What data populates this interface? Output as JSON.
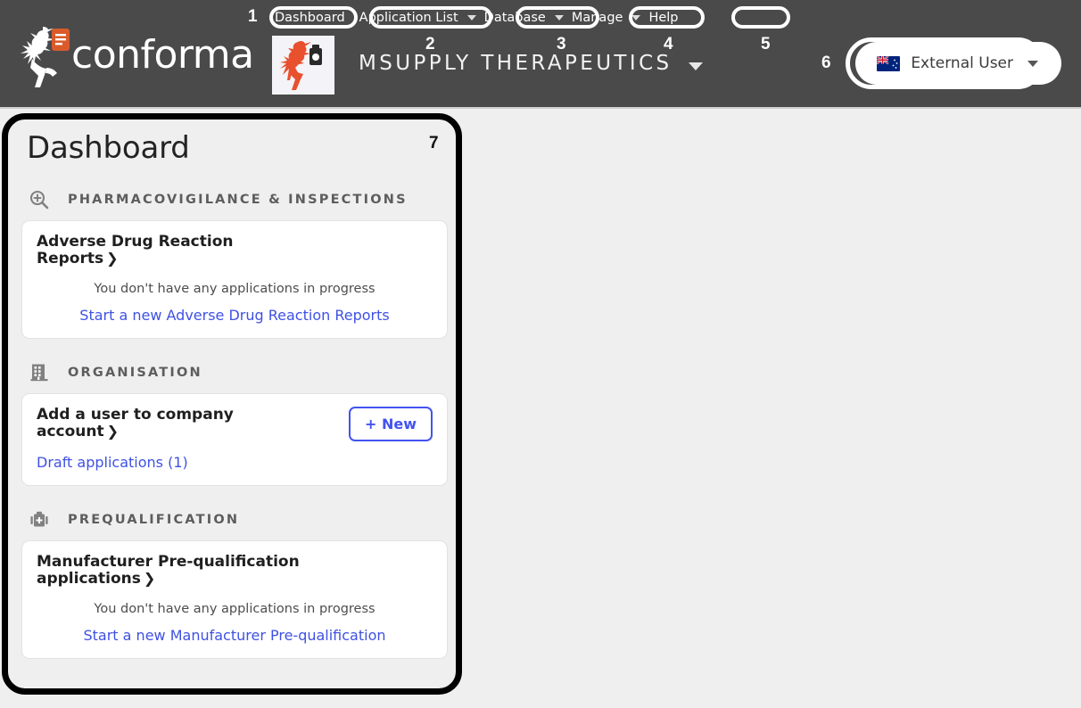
{
  "header": {
    "brand_name": "conforma",
    "brand_icon": "conforma-runner-document-logo",
    "org_logo_icon": "msupply-runner-bottle-logo",
    "org_title": "MSUPPLY THERAPEUTICS",
    "org_title_caret_icon": "chevron-down-icon",
    "background_color": "#4a4a4a",
    "nav": [
      {
        "label": "Dashboard",
        "has_caret": false
      },
      {
        "label": "Application List",
        "has_caret": true
      },
      {
        "label": "Database",
        "has_caret": true
      },
      {
        "label": "Manage",
        "has_caret": true
      },
      {
        "label": "Help",
        "has_caret": false
      }
    ],
    "user": {
      "flag_icon": "new-zealand-flag-icon",
      "name": "External User",
      "caret_icon": "chevron-down-icon"
    }
  },
  "annotations": [
    {
      "number": "1"
    },
    {
      "number": "2"
    },
    {
      "number": "3"
    },
    {
      "number": "4"
    },
    {
      "number": "5"
    },
    {
      "number": "6"
    },
    {
      "number": "7"
    }
  ],
  "dashboard": {
    "title": "Dashboard",
    "accent_color": "#4353f0",
    "link_color": "#3f51e3",
    "sections": [
      {
        "icon": "magnifier-plus-icon",
        "label": "PHARMACOVIGILANCE & INSPECTIONS",
        "card": {
          "title": "Adverse Drug Reaction Reports",
          "chevron": "❯",
          "empty_text": "You don't have any applications in progress",
          "link": "Start a new Adverse Drug Reaction Reports",
          "has_new_button": false
        }
      },
      {
        "icon": "building-icon",
        "label": "ORGANISATION",
        "card": {
          "title": "Add a user to company account",
          "chevron": "❯",
          "empty_text": "",
          "link": "Draft applications (1)",
          "has_new_button": true,
          "new_button_label": "+ New"
        }
      },
      {
        "icon": "medical-kit-icon",
        "label": "PREQUALIFICATION",
        "card": {
          "title": "Manufacturer Pre-qualification applications",
          "chevron": "❯",
          "empty_text": "You don't have any applications in progress",
          "link": "Start a new Manufacturer Pre-qualification",
          "has_new_button": false
        }
      }
    ]
  }
}
